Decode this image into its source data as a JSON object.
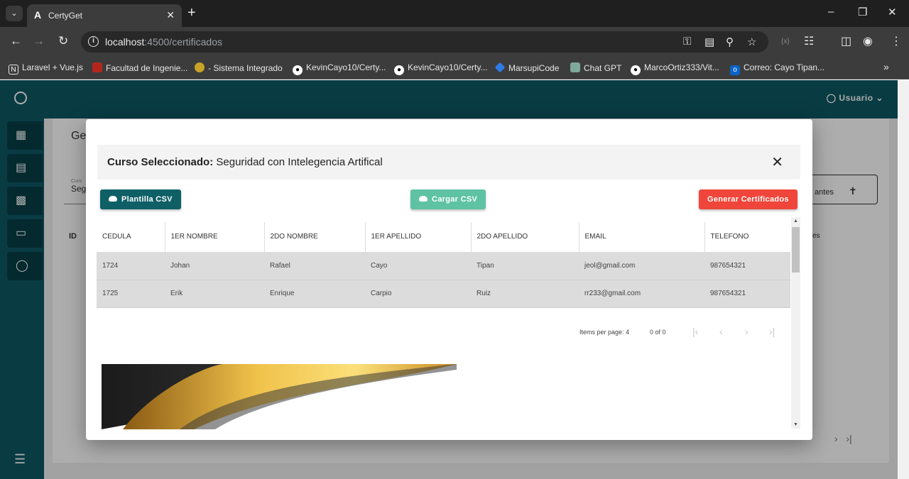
{
  "browser": {
    "tab_title": "CertyGet",
    "tab_favicon": "A",
    "url_host": "localhost",
    "url_rest": ":4500/certificados",
    "bookmarks": [
      "Laravel + Vue.js",
      "Facultad de Ingenie...",
      "- Sistema Integrado",
      "KevinCayo10/Certy...",
      "KevinCayo10/Certy...",
      "MarsupiCode",
      "Chat GPT",
      "MarcoOrtiz333/Vit...",
      "Correo: Cayo Tipan..."
    ]
  },
  "app": {
    "user_label": "Usuario",
    "bg_title": "Ges",
    "bg_field_label": "Curs",
    "bg_field_value": "Seg",
    "bg_button_label": "antes",
    "bg_col_id": "ID",
    "bg_col_es": "es"
  },
  "modal": {
    "title_prefix": "Curso Seleccionado:",
    "title_course": "Seguridad con Intelegencia Artifical",
    "btn_plantilla": "Plantilla CSV",
    "btn_cargar": "Cargar CSV",
    "btn_generar": "Generar Certificados",
    "columns": [
      "CEDULA",
      "1ER NOMBRE",
      "2DO NOMBRE",
      "1ER APELLIDO",
      "2DO APELLIDO",
      "EMAIL",
      "TELEFONO"
    ],
    "rows": [
      [
        "1724",
        "Johan",
        "Rafael",
        "Cayo",
        "Tipan",
        "jeol@gmail.com",
        "987654321"
      ],
      [
        "1725",
        "Erik",
        "Enrique",
        "Carpio",
        "Ruiz",
        "rr233@gmail.com",
        "987654321"
      ]
    ],
    "paginator": {
      "items_per_page_label": "Items per page:",
      "items_per_page": "4",
      "range": "0 of 0"
    }
  },
  "colors": {
    "primary": "#0e5763",
    "btn_plantilla": "#0e5f66",
    "btn_cargar": "#5ec2a3",
    "btn_generar": "#f0453a"
  }
}
